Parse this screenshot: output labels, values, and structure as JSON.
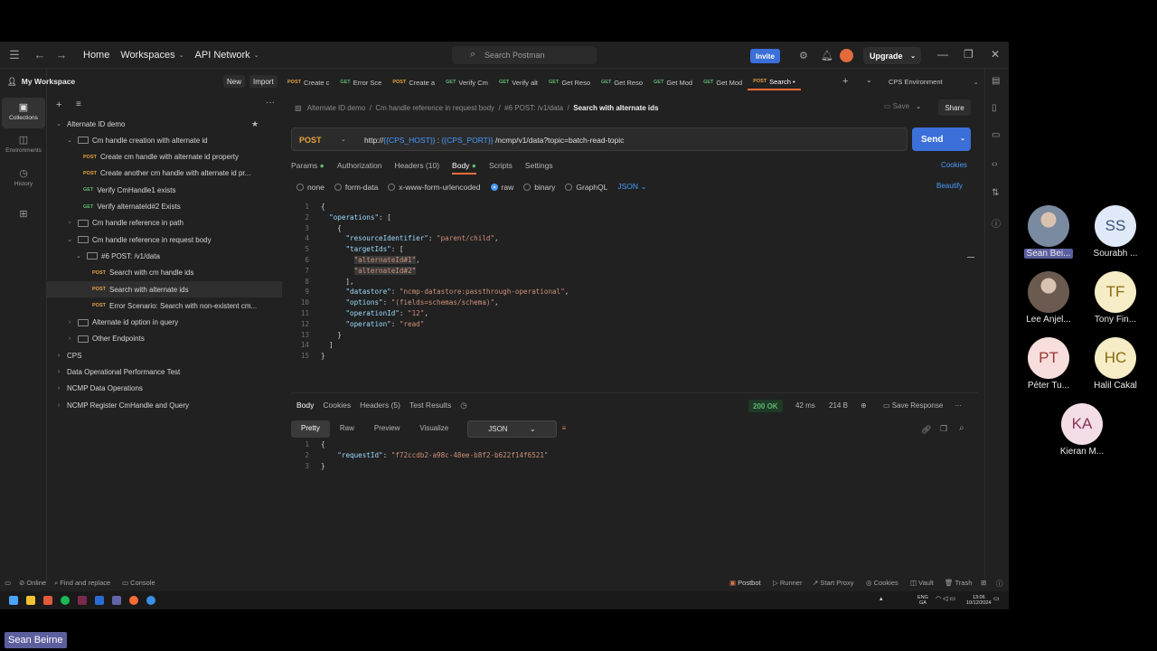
{
  "topbar": {
    "home": "Home",
    "workspaces": "Workspaces",
    "api_network": "API Network",
    "search_placeholder": "Search Postman",
    "invite": "Invite",
    "upgrade": "Upgrade"
  },
  "sidebar": {
    "workspace_name": "My Workspace",
    "new_label": "New",
    "import_label": "Import",
    "rail": [
      {
        "label": "Collections",
        "icon": "collections-icon"
      },
      {
        "label": "Environments",
        "icon": "environments-icon"
      },
      {
        "label": "History",
        "icon": "history-icon"
      },
      {
        "label": "",
        "icon": "apps-icon"
      }
    ],
    "tree": [
      {
        "label": "Alternate ID demo",
        "type": "collection",
        "level": 0,
        "open": true
      },
      {
        "label": "Cm handle creation with alternate id",
        "type": "folder",
        "level": 1,
        "open": true
      },
      {
        "label": "Create cm handle with alternate id property",
        "type": "POST",
        "level": 2
      },
      {
        "label": "Create another cm handle with alternate id pr...",
        "type": "POST",
        "level": 2
      },
      {
        "label": "Verify CmHandle1 exists",
        "type": "GET",
        "level": 2
      },
      {
        "label": "Verify alternateId#2 Exists",
        "type": "GET",
        "level": 2
      },
      {
        "label": "Cm handle reference in path",
        "type": "folder",
        "level": 1,
        "open": false
      },
      {
        "label": "Cm handle reference in request body",
        "type": "folder",
        "level": 1,
        "open": true
      },
      {
        "label": "#6 POST: /v1/data",
        "type": "folder",
        "level": 2,
        "open": true
      },
      {
        "label": "Search with cm handle ids",
        "type": "POST",
        "level": 3
      },
      {
        "label": "Search with alternate ids",
        "type": "POST",
        "level": 3,
        "selected": true
      },
      {
        "label": "Error Scenario: Search with non-existent cm...",
        "type": "POST",
        "level": 3
      },
      {
        "label": "Alternate id option in query",
        "type": "folder",
        "level": 1,
        "open": false
      },
      {
        "label": "Other Endpoints",
        "type": "folder",
        "level": 1,
        "open": false
      },
      {
        "label": "CPS",
        "type": "collection",
        "level": 0,
        "open": false
      },
      {
        "label": "Data Operational Performance Test",
        "type": "collection",
        "level": 0,
        "open": false
      },
      {
        "label": "NCMP Data Operations",
        "type": "collection",
        "level": 0,
        "open": false
      },
      {
        "label": "NCMP Register CmHandle and Query",
        "type": "collection",
        "level": 0,
        "open": false
      }
    ]
  },
  "tabs": [
    {
      "method": "POST",
      "label": "Create c"
    },
    {
      "method": "GET",
      "label": "Error Sce"
    },
    {
      "method": "POST",
      "label": "Create a"
    },
    {
      "method": "GET",
      "label": "Verify Cm"
    },
    {
      "method": "GET",
      "label": "Verify alt"
    },
    {
      "method": "GET",
      "label": "Get Reso"
    },
    {
      "method": "GET",
      "label": "Get Reso"
    },
    {
      "method": "GET",
      "label": "Get Mod"
    },
    {
      "method": "GET",
      "label": "Get Mod"
    },
    {
      "method": "POST",
      "label": "Search •",
      "active": true
    }
  ],
  "environment": "CPS Environment",
  "breadcrumb": {
    "items": [
      "Alternate ID demo",
      "Cm handle reference in request body",
      "#6 POST: /v1/data"
    ],
    "current": "Search with alternate ids"
  },
  "actions": {
    "save": "Save",
    "share": "Share",
    "send": "Send"
  },
  "request": {
    "method": "POST",
    "url_prefix": "http://",
    "url_var1": "{{CPS_HOST}}",
    "url_sep": " : ",
    "url_var2": "{{CPS_PORT}}",
    "url_path": "/ncmp/v1/data?topic=batch-read-topic"
  },
  "request_tabs": [
    "Params",
    "Authorization",
    "Headers (10)",
    "Body",
    "Scripts",
    "Settings"
  ],
  "cookies": "Cookies",
  "body_modes": [
    "none",
    "form-data",
    "x-www-form-urlencoded",
    "raw",
    "binary",
    "GraphQL"
  ],
  "body_format": "JSON",
  "beautify": "Beautify",
  "request_body_lines": [
    "{",
    "  \"operations\": [",
    "    {",
    "      \"resourceIdentifier\": \"parent/child\",",
    "      \"targetIds\": [",
    "        \"alternateId#1\",",
    "        \"alternateId#2\"",
    "      ],",
    "      \"datastore\": \"ncmp-datastore:passthrough-operational\",",
    "      \"options\": \"(fields=schemas/schema)\",",
    "      \"operationId\": \"12\",",
    "      \"operation\": \"read\"",
    "    }",
    "  ]",
    "}"
  ],
  "response": {
    "tabs": [
      "Body",
      "Cookies",
      "Headers (5)",
      "Test Results"
    ],
    "status": "200 OK",
    "time": "42 ms",
    "size": "214 B",
    "save_response": "Save Response",
    "formats": [
      "Pretty",
      "Raw",
      "Preview",
      "Visualize"
    ],
    "format": "JSON",
    "lines": [
      "{",
      "    \"requestId\": \"f72ccdb2-a98c-48ee-b8f2-b622f14f6521\"",
      "}"
    ]
  },
  "statusbar": {
    "online": "Online",
    "find_replace": "Find and replace",
    "console": "Console",
    "postbot": "Postbot",
    "runner": "Runner",
    "start_proxy": "Start Proxy",
    "cookies": "Cookies",
    "vault": "Vault",
    "trash": "Trash"
  },
  "taskbar": {
    "lang": "ENG\nGA",
    "time": "13:06",
    "date": "10/12/2024"
  },
  "participants": [
    {
      "initials": "",
      "name": "Sean Bei...",
      "bg": "#7a8aa0",
      "fg": "#ffffff",
      "photo": true,
      "highlight": true
    },
    {
      "initials": "SS",
      "name": "Sourabh ...",
      "bg": "#dfe9f7",
      "fg": "#3a4f7a"
    },
    {
      "initials": "",
      "name": "Lee Anjel...",
      "bg": "#6b5a50",
      "fg": "#ffffff",
      "photo": true
    },
    {
      "initials": "TF",
      "name": "Tony Fin...",
      "bg": "#f6ecc5",
      "fg": "#8a6a10"
    },
    {
      "initials": "PT",
      "name": "Péter Tu...",
      "bg": "#f7dedc",
      "fg": "#9a3a34"
    },
    {
      "initials": "HC",
      "name": "Halil Cakal",
      "bg": "#f6ecc5",
      "fg": "#8a6a10"
    },
    {
      "initials": "KA",
      "name": "Kieran M...",
      "bg": "#f3dde6",
      "fg": "#8a3456"
    }
  ],
  "presenter_label": "Sean Beirne"
}
